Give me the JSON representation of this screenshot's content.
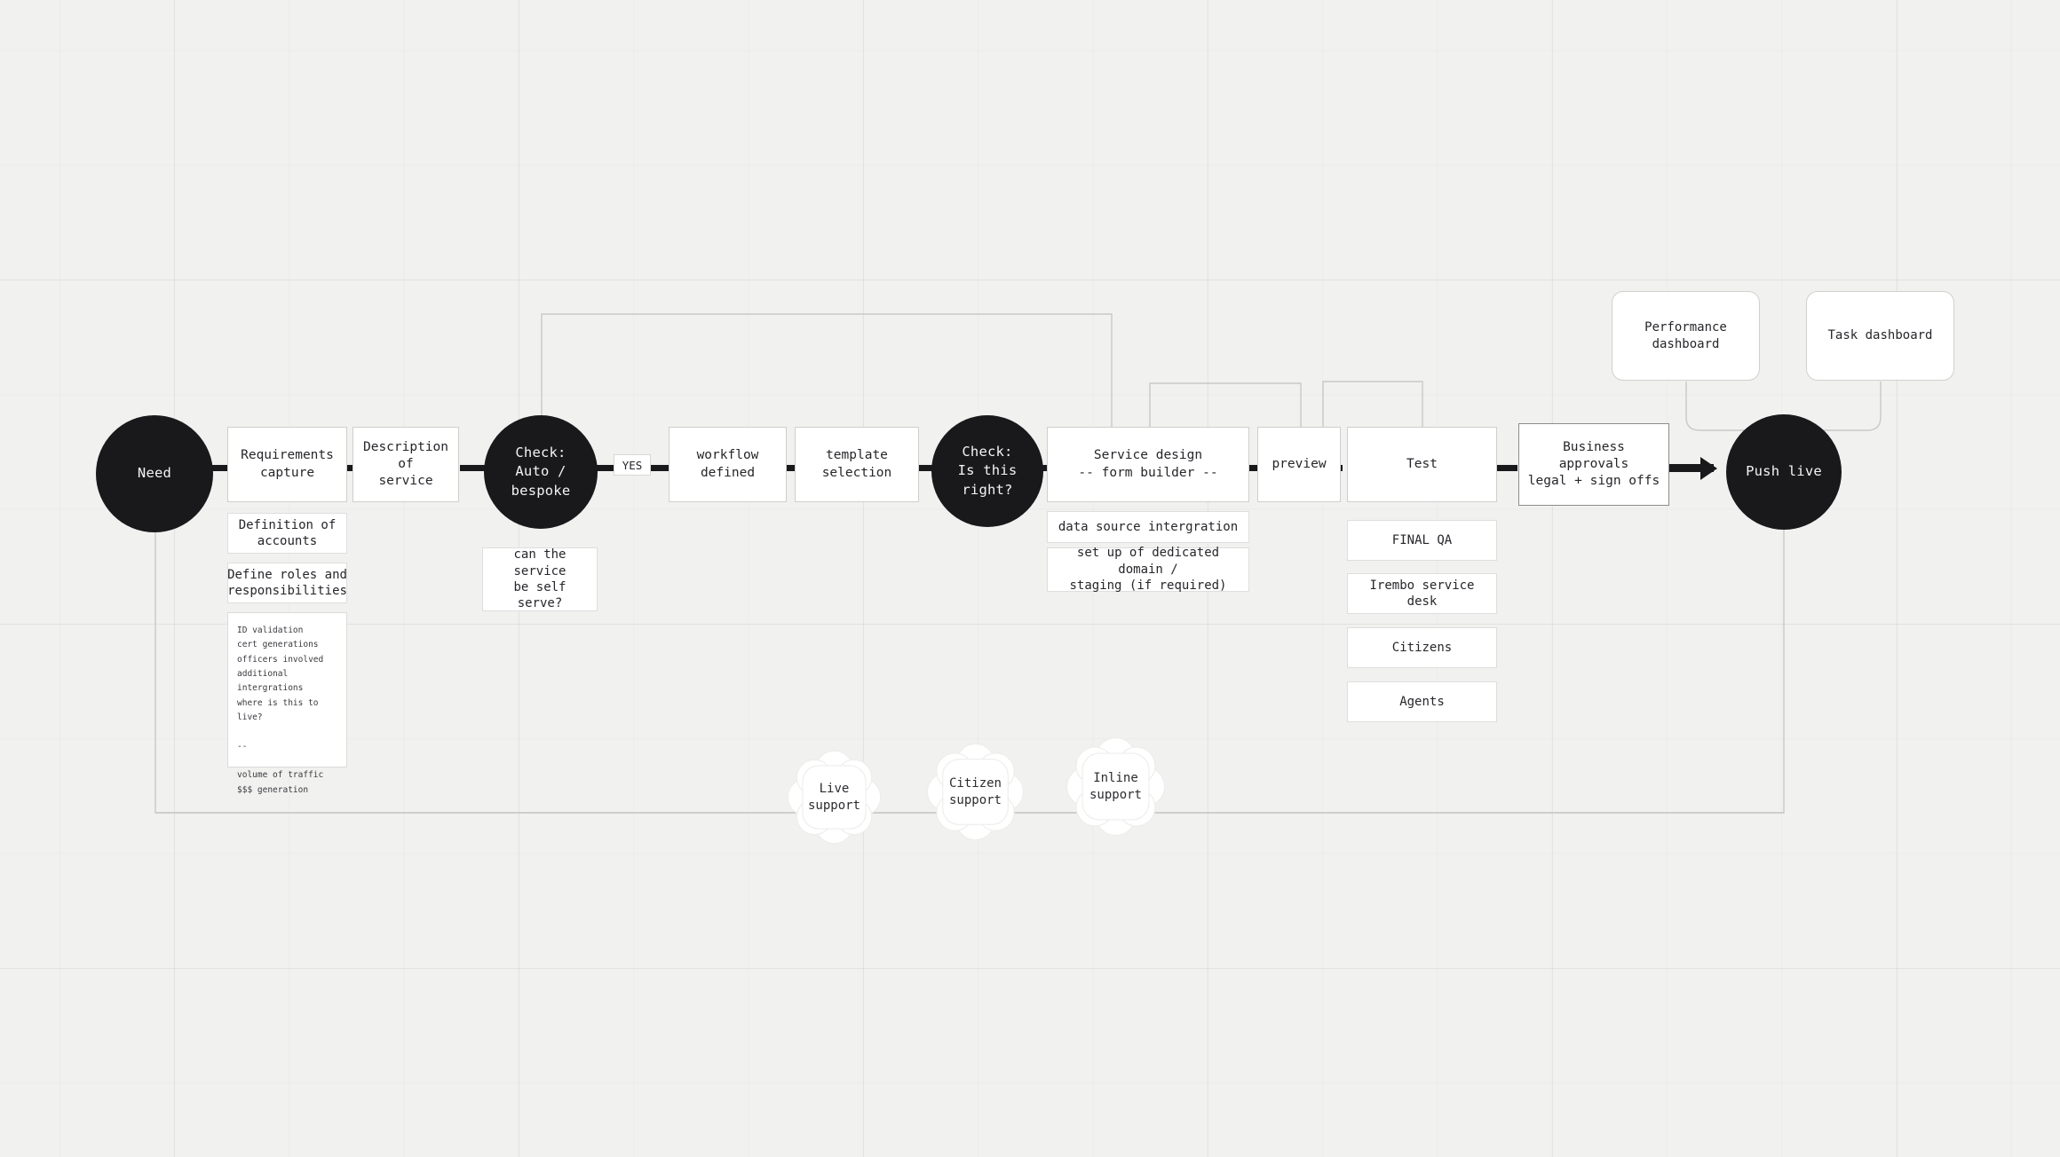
{
  "board": {
    "title": "Service design delivery flow",
    "background_color": "#f1f1f0",
    "node_fill": "#ffffff",
    "accent_dark": "#19191c",
    "wire_color": "#c7c7c5"
  },
  "circles": {
    "need": "Need",
    "check_auto": "Check:\nAuto /\nbespoke",
    "check_right": "Check:\nIs this\nright?",
    "push_live": "Push live"
  },
  "chips": {
    "yes": "YES"
  },
  "main_steps": [
    {
      "id": "requirements-capture",
      "label": "Requirements\ncapture"
    },
    {
      "id": "description-of-service",
      "label": "Description of\nservice"
    },
    {
      "id": "workflow-defined",
      "label": "workflow\ndefined"
    },
    {
      "id": "template-selection",
      "label": "template\nselection"
    },
    {
      "id": "service-design",
      "label": "Service design\n-- form builder --"
    },
    {
      "id": "preview",
      "label": "preview"
    },
    {
      "id": "test",
      "label": "Test"
    },
    {
      "id": "business-approvals",
      "label": "Business approvals\nlegal + sign offs"
    }
  ],
  "requirements_children": [
    {
      "id": "definition-of-accounts",
      "label": "Definition of\naccounts"
    },
    {
      "id": "define-roles",
      "label": "Define roles and\nresponsibilities"
    }
  ],
  "requirements_note": "ID validation\ncert generations\nofficers involved\nadditional\nintergrations\nwhere is this to\nlive?\n\n--\n\nvolume of traffic\n$$$ generation",
  "check_auto_note": "can the service\nbe self serve?",
  "service_design_children": [
    {
      "id": "data-source-intergration",
      "label": "data source intergration"
    },
    {
      "id": "dedicated-domain",
      "label": "set up of dedicated domain /\nstaging (if required)"
    }
  ],
  "test_children": [
    {
      "id": "final-qa",
      "label": "FINAL QA"
    },
    {
      "id": "irembo-service-desk",
      "label": "Irembo service desk"
    },
    {
      "id": "citizens",
      "label": "Citizens"
    },
    {
      "id": "agents",
      "label": "Agents"
    }
  ],
  "dashboards": [
    {
      "id": "performance-dashboard",
      "label": "Performance\ndashboard"
    },
    {
      "id": "task-dashboard",
      "label": "Task dashboard"
    }
  ],
  "support_clouds": [
    {
      "id": "live-support",
      "label": "Live\nsupport"
    },
    {
      "id": "citizen-support",
      "label": "Citizen\nsupport"
    },
    {
      "id": "inline-support",
      "label": "Inline\nsupport"
    }
  ]
}
